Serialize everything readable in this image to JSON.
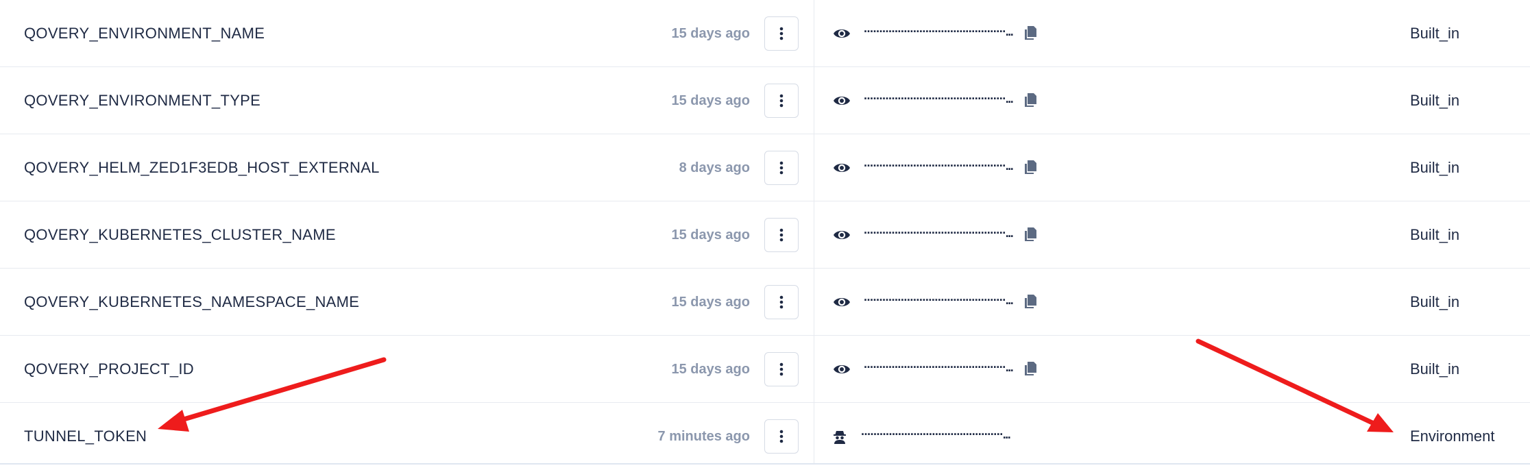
{
  "rows": [
    {
      "name": "QOVERY_ENVIRONMENT_NAME",
      "updated": "15 days ago",
      "value_mask": "··············································...",
      "scope": "Built_in",
      "visibility_icon": "eye-icon",
      "copyable": true
    },
    {
      "name": "QOVERY_ENVIRONMENT_TYPE",
      "updated": "15 days ago",
      "value_mask": "··············································...",
      "scope": "Built_in",
      "visibility_icon": "eye-icon",
      "copyable": true
    },
    {
      "name": "QOVERY_HELM_ZED1F3EDB_HOST_EXTERNAL",
      "updated": "8 days ago",
      "value_mask": "··············································...",
      "scope": "Built_in",
      "visibility_icon": "eye-icon",
      "copyable": true
    },
    {
      "name": "QOVERY_KUBERNETES_CLUSTER_NAME",
      "updated": "15 days ago",
      "value_mask": "··············································...",
      "scope": "Built_in",
      "visibility_icon": "eye-icon",
      "copyable": true
    },
    {
      "name": "QOVERY_KUBERNETES_NAMESPACE_NAME",
      "updated": "15 days ago",
      "value_mask": "··············································...",
      "scope": "Built_in",
      "visibility_icon": "eye-icon",
      "copyable": true
    },
    {
      "name": "QOVERY_PROJECT_ID",
      "updated": "15 days ago",
      "value_mask": "··············································...",
      "scope": "Built_in",
      "visibility_icon": "eye-icon",
      "copyable": true
    },
    {
      "name": "TUNNEL_TOKEN",
      "updated": "7 minutes ago",
      "value_mask": "··············································...",
      "scope": "Environment",
      "visibility_icon": "secret-agent-icon",
      "copyable": false
    }
  ],
  "colors": {
    "text": "#1f2a44",
    "muted": "#8b97ad",
    "border": "#e7eaf0",
    "annotation_arrow": "#ee1c1c"
  }
}
